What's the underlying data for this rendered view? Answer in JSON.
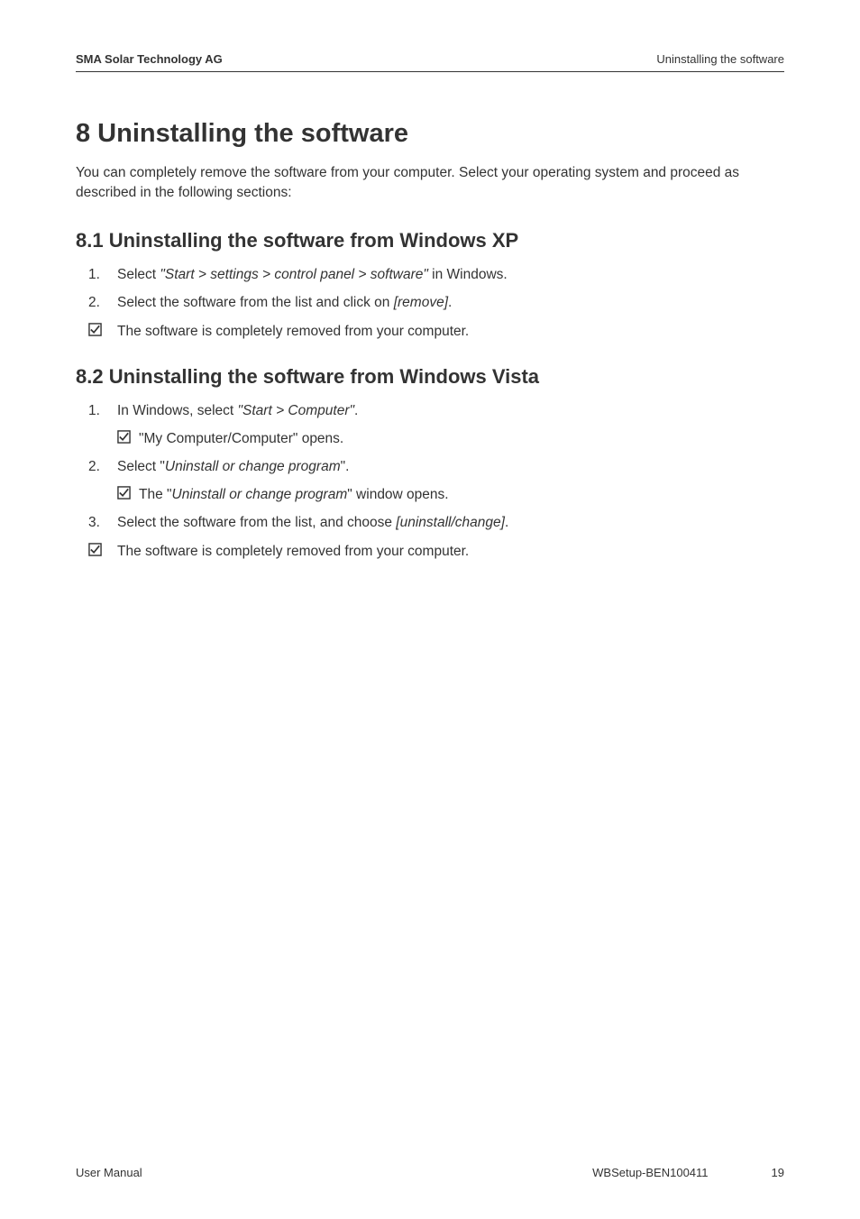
{
  "header": {
    "left": "SMA Solar Technology AG",
    "right": "Uninstalling the software"
  },
  "h1": "8  Uninstalling the software",
  "intro": "You can completely remove the software from your computer. Select your operating system and proceed as described in the following sections:",
  "section_8_1": {
    "heading": "8.1  Uninstalling the software from Windows XP",
    "items": [
      {
        "marker": "1.",
        "before": "Select ",
        "italic": "\"Start > settings > control panel > software\"",
        "after": " in Windows."
      },
      {
        "marker": "2.",
        "before": "Select the software from the list and click on ",
        "italic": "[remove]",
        "after": "."
      },
      {
        "marker": "check",
        "before": "The software is completely removed from your computer.",
        "italic": "",
        "after": ""
      }
    ]
  },
  "section_8_2": {
    "heading": "8.2  Uninstalling the software from Windows Vista",
    "items": [
      {
        "marker": "1.",
        "before": "In Windows, select ",
        "italic": "\"Start > Computer\"",
        "after": ".",
        "sub": {
          "marker": "check",
          "text": "\"My Computer/Computer\" opens."
        }
      },
      {
        "marker": "2.",
        "before": "Select \"",
        "italic": "Uninstall or change program",
        "after": "\".",
        "sub": {
          "marker": "check",
          "before": "The \"",
          "italic": "Uninstall or change program",
          "after": "\" window opens."
        }
      },
      {
        "marker": "3.",
        "before": "Select the software from the list, and choose ",
        "italic": "[uninstall/change]",
        "after": "."
      },
      {
        "marker": "check",
        "before": "The software is completely removed from your computer.",
        "italic": "",
        "after": ""
      }
    ]
  },
  "footer": {
    "left": "User Manual",
    "doc_id": "WBSetup-BEN100411",
    "page": "19"
  }
}
